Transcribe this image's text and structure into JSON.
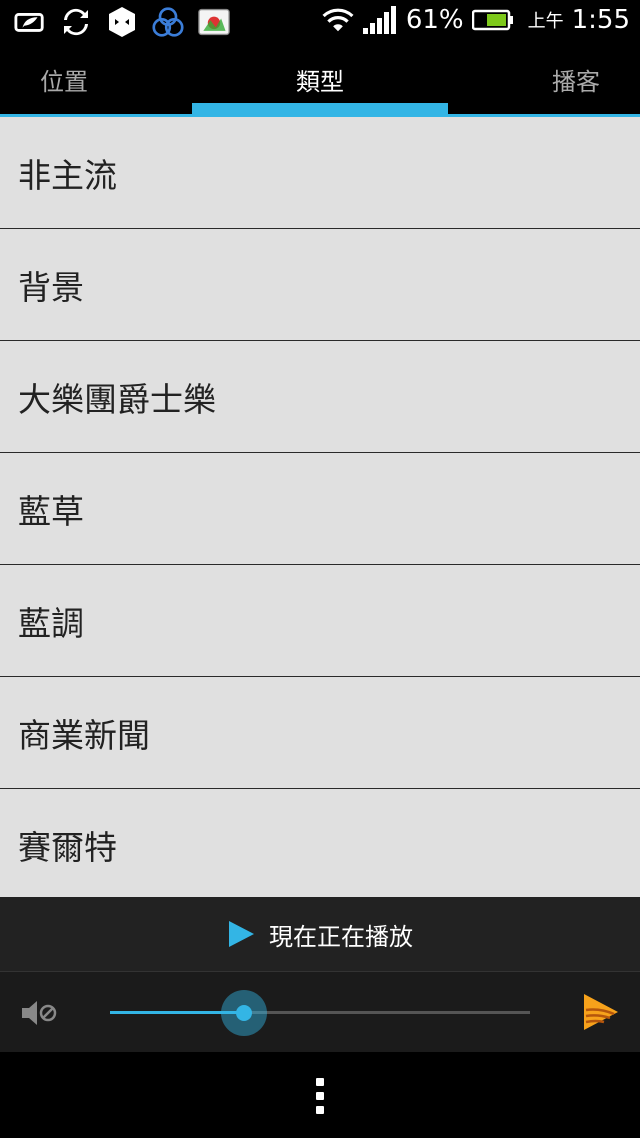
{
  "status": {
    "battery_percent": "61%",
    "ampm": "上午",
    "time": "1:55"
  },
  "tabs": [
    {
      "label": "位置"
    },
    {
      "label": "類型"
    },
    {
      "label": "播客"
    }
  ],
  "genres": [
    {
      "label": "非主流"
    },
    {
      "label": "背景"
    },
    {
      "label": "大樂團爵士樂"
    },
    {
      "label": "藍草"
    },
    {
      "label": "藍調"
    },
    {
      "label": "商業新聞"
    },
    {
      "label": "賽爾特"
    }
  ],
  "now_playing": {
    "label": "現在正在播放"
  },
  "volume": {
    "level": 0.32
  },
  "icons": {
    "accent_color": "#33b5e5",
    "list_bg": "#e0e0e0",
    "brand_color": "#f7a21b"
  }
}
